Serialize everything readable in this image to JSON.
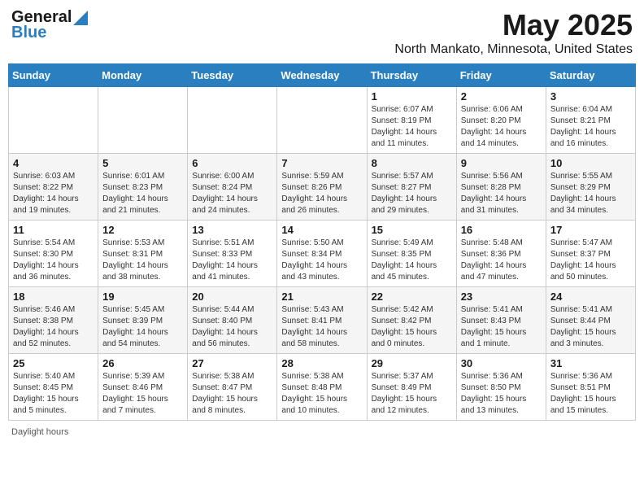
{
  "header": {
    "logo_line1": "General",
    "logo_line2": "Blue",
    "month": "May 2025",
    "location": "North Mankato, Minnesota, United States"
  },
  "weekdays": [
    "Sunday",
    "Monday",
    "Tuesday",
    "Wednesday",
    "Thursday",
    "Friday",
    "Saturday"
  ],
  "weeks": [
    [
      {
        "day": "",
        "sunrise": "",
        "sunset": "",
        "daylight": ""
      },
      {
        "day": "",
        "sunrise": "",
        "sunset": "",
        "daylight": ""
      },
      {
        "day": "",
        "sunrise": "",
        "sunset": "",
        "daylight": ""
      },
      {
        "day": "",
        "sunrise": "",
        "sunset": "",
        "daylight": ""
      },
      {
        "day": "1",
        "sunrise": "Sunrise: 6:07 AM",
        "sunset": "Sunset: 8:19 PM",
        "daylight": "Daylight: 14 hours and 11 minutes."
      },
      {
        "day": "2",
        "sunrise": "Sunrise: 6:06 AM",
        "sunset": "Sunset: 8:20 PM",
        "daylight": "Daylight: 14 hours and 14 minutes."
      },
      {
        "day": "3",
        "sunrise": "Sunrise: 6:04 AM",
        "sunset": "Sunset: 8:21 PM",
        "daylight": "Daylight: 14 hours and 16 minutes."
      }
    ],
    [
      {
        "day": "4",
        "sunrise": "Sunrise: 6:03 AM",
        "sunset": "Sunset: 8:22 PM",
        "daylight": "Daylight: 14 hours and 19 minutes."
      },
      {
        "day": "5",
        "sunrise": "Sunrise: 6:01 AM",
        "sunset": "Sunset: 8:23 PM",
        "daylight": "Daylight: 14 hours and 21 minutes."
      },
      {
        "day": "6",
        "sunrise": "Sunrise: 6:00 AM",
        "sunset": "Sunset: 8:24 PM",
        "daylight": "Daylight: 14 hours and 24 minutes."
      },
      {
        "day": "7",
        "sunrise": "Sunrise: 5:59 AM",
        "sunset": "Sunset: 8:26 PM",
        "daylight": "Daylight: 14 hours and 26 minutes."
      },
      {
        "day": "8",
        "sunrise": "Sunrise: 5:57 AM",
        "sunset": "Sunset: 8:27 PM",
        "daylight": "Daylight: 14 hours and 29 minutes."
      },
      {
        "day": "9",
        "sunrise": "Sunrise: 5:56 AM",
        "sunset": "Sunset: 8:28 PM",
        "daylight": "Daylight: 14 hours and 31 minutes."
      },
      {
        "day": "10",
        "sunrise": "Sunrise: 5:55 AM",
        "sunset": "Sunset: 8:29 PM",
        "daylight": "Daylight: 14 hours and 34 minutes."
      }
    ],
    [
      {
        "day": "11",
        "sunrise": "Sunrise: 5:54 AM",
        "sunset": "Sunset: 8:30 PM",
        "daylight": "Daylight: 14 hours and 36 minutes."
      },
      {
        "day": "12",
        "sunrise": "Sunrise: 5:53 AM",
        "sunset": "Sunset: 8:31 PM",
        "daylight": "Daylight: 14 hours and 38 minutes."
      },
      {
        "day": "13",
        "sunrise": "Sunrise: 5:51 AM",
        "sunset": "Sunset: 8:33 PM",
        "daylight": "Daylight: 14 hours and 41 minutes."
      },
      {
        "day": "14",
        "sunrise": "Sunrise: 5:50 AM",
        "sunset": "Sunset: 8:34 PM",
        "daylight": "Daylight: 14 hours and 43 minutes."
      },
      {
        "day": "15",
        "sunrise": "Sunrise: 5:49 AM",
        "sunset": "Sunset: 8:35 PM",
        "daylight": "Daylight: 14 hours and 45 minutes."
      },
      {
        "day": "16",
        "sunrise": "Sunrise: 5:48 AM",
        "sunset": "Sunset: 8:36 PM",
        "daylight": "Daylight: 14 hours and 47 minutes."
      },
      {
        "day": "17",
        "sunrise": "Sunrise: 5:47 AM",
        "sunset": "Sunset: 8:37 PM",
        "daylight": "Daylight: 14 hours and 50 minutes."
      }
    ],
    [
      {
        "day": "18",
        "sunrise": "Sunrise: 5:46 AM",
        "sunset": "Sunset: 8:38 PM",
        "daylight": "Daylight: 14 hours and 52 minutes."
      },
      {
        "day": "19",
        "sunrise": "Sunrise: 5:45 AM",
        "sunset": "Sunset: 8:39 PM",
        "daylight": "Daylight: 14 hours and 54 minutes."
      },
      {
        "day": "20",
        "sunrise": "Sunrise: 5:44 AM",
        "sunset": "Sunset: 8:40 PM",
        "daylight": "Daylight: 14 hours and 56 minutes."
      },
      {
        "day": "21",
        "sunrise": "Sunrise: 5:43 AM",
        "sunset": "Sunset: 8:41 PM",
        "daylight": "Daylight: 14 hours and 58 minutes."
      },
      {
        "day": "22",
        "sunrise": "Sunrise: 5:42 AM",
        "sunset": "Sunset: 8:42 PM",
        "daylight": "Daylight: 15 hours and 0 minutes."
      },
      {
        "day": "23",
        "sunrise": "Sunrise: 5:41 AM",
        "sunset": "Sunset: 8:43 PM",
        "daylight": "Daylight: 15 hours and 1 minute."
      },
      {
        "day": "24",
        "sunrise": "Sunrise: 5:41 AM",
        "sunset": "Sunset: 8:44 PM",
        "daylight": "Daylight: 15 hours and 3 minutes."
      }
    ],
    [
      {
        "day": "25",
        "sunrise": "Sunrise: 5:40 AM",
        "sunset": "Sunset: 8:45 PM",
        "daylight": "Daylight: 15 hours and 5 minutes."
      },
      {
        "day": "26",
        "sunrise": "Sunrise: 5:39 AM",
        "sunset": "Sunset: 8:46 PM",
        "daylight": "Daylight: 15 hours and 7 minutes."
      },
      {
        "day": "27",
        "sunrise": "Sunrise: 5:38 AM",
        "sunset": "Sunset: 8:47 PM",
        "daylight": "Daylight: 15 hours and 8 minutes."
      },
      {
        "day": "28",
        "sunrise": "Sunrise: 5:38 AM",
        "sunset": "Sunset: 8:48 PM",
        "daylight": "Daylight: 15 hours and 10 minutes."
      },
      {
        "day": "29",
        "sunrise": "Sunrise: 5:37 AM",
        "sunset": "Sunset: 8:49 PM",
        "daylight": "Daylight: 15 hours and 12 minutes."
      },
      {
        "day": "30",
        "sunrise": "Sunrise: 5:36 AM",
        "sunset": "Sunset: 8:50 PM",
        "daylight": "Daylight: 15 hours and 13 minutes."
      },
      {
        "day": "31",
        "sunrise": "Sunrise: 5:36 AM",
        "sunset": "Sunset: 8:51 PM",
        "daylight": "Daylight: 15 hours and 15 minutes."
      }
    ]
  ],
  "footer": "Daylight hours"
}
